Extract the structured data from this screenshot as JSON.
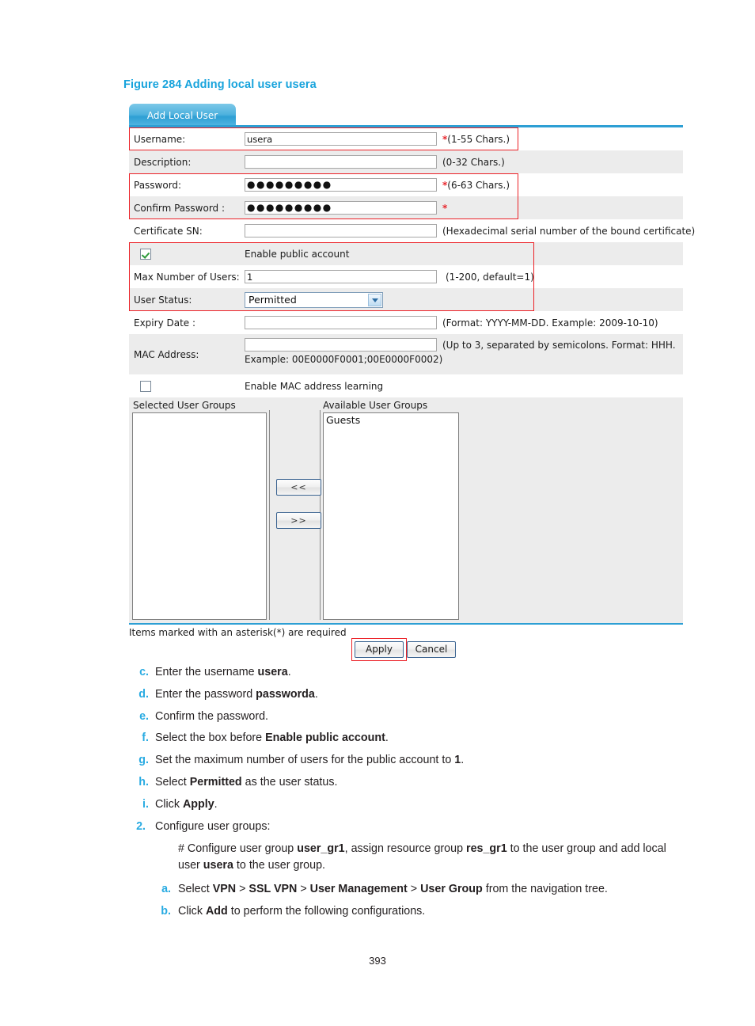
{
  "figure": {
    "caption": "Figure 284 Adding local user usera"
  },
  "panel": {
    "tab_label": "Add Local User",
    "rows": [
      {
        "label": "Username:",
        "value": "usera",
        "hint": "(1-55 Chars.)",
        "required": true
      },
      {
        "label": "Description:",
        "value": "",
        "hint": "(0-32 Chars.)",
        "required": false
      },
      {
        "label": "Password:",
        "value": "●●●●●●●●●",
        "hint": "(6-63 Chars.)",
        "required": true
      },
      {
        "label": "Confirm Password :",
        "value": "●●●●●●●●●",
        "hint": "",
        "required": true
      },
      {
        "label": "Certificate SN:",
        "value": "",
        "hint": "(Hexadecimal serial number of the bound certificate)",
        "required": false
      }
    ],
    "public_account": {
      "checkbox_label": "Enable public account",
      "checked": true,
      "max_users_label": "Max Number of Users:",
      "max_users_value": "1",
      "max_users_hint": "(1-200, default=1)",
      "user_status_label": "User Status:",
      "user_status_value": "Permitted",
      "user_status_options": [
        "Permitted"
      ]
    },
    "expiry": {
      "label": "Expiry Date :",
      "value": "",
      "hint": "(Format: YYYY-MM-DD. Example: 2009-10-10)"
    },
    "mac": {
      "label": "MAC Address:",
      "value": "",
      "hint": "(Up to 3, separated by semicolons. Format: HHH.",
      "example": "Example: 00E0000F0001;00E0000F0002)"
    },
    "mac_learning": {
      "checkbox_label": "Enable MAC address learning",
      "checked": false
    },
    "groups": {
      "selected_label": "Selected User Groups",
      "available_label": "Available User Groups",
      "selected_items": [],
      "available_items": [
        "Guests"
      ],
      "move_left_label": "<<",
      "move_right_label": ">>"
    },
    "footnote": "Items marked with an asterisk(*) are required",
    "apply_label": "Apply",
    "cancel_label": "Cancel",
    "accent_color": "#2d9fd4",
    "highlight_color": "#ec2127"
  },
  "instructions": {
    "steps": [
      {
        "marker": "c.",
        "parts": [
          {
            "t": "Enter the username "
          },
          {
            "t": "usera",
            "b": true
          },
          {
            "t": "."
          }
        ]
      },
      {
        "marker": "d.",
        "parts": [
          {
            "t": "Enter the password "
          },
          {
            "t": "passworda",
            "b": true
          },
          {
            "t": "."
          }
        ]
      },
      {
        "marker": "e.",
        "parts": [
          {
            "t": "Confirm the password."
          }
        ]
      },
      {
        "marker": "f.",
        "parts": [
          {
            "t": "Select the box before "
          },
          {
            "t": "Enable public account",
            "b": true
          },
          {
            "t": "."
          }
        ]
      },
      {
        "marker": "g.",
        "parts": [
          {
            "t": "Set the maximum number of users for the public account to "
          },
          {
            "t": "1",
            "b": true
          },
          {
            "t": "."
          }
        ]
      },
      {
        "marker": "h.",
        "parts": [
          {
            "t": "Select "
          },
          {
            "t": "Permitted",
            "b": true
          },
          {
            "t": " as the user status."
          }
        ]
      },
      {
        "marker": "i.",
        "parts": [
          {
            "t": "Click "
          },
          {
            "t": "Apply",
            "b": true
          },
          {
            "t": "."
          }
        ]
      }
    ],
    "step2": {
      "marker": "2.",
      "title": "Configure user groups:",
      "paragraph": [
        {
          "t": "# Configure user group "
        },
        {
          "t": "user_gr1",
          "b": true
        },
        {
          "t": ", assign resource group "
        },
        {
          "t": "res_gr1",
          "b": true
        },
        {
          "t": " to the user group and add local user "
        },
        {
          "t": "usera",
          "b": true
        },
        {
          "t": " to the user group."
        }
      ],
      "substeps": [
        {
          "marker": "a.",
          "parts": [
            {
              "t": "Select "
            },
            {
              "t": "VPN",
              "b": true
            },
            {
              "t": " > "
            },
            {
              "t": "SSL VPN",
              "b": true
            },
            {
              "t": " > "
            },
            {
              "t": "User Management",
              "b": true
            },
            {
              "t": " > "
            },
            {
              "t": "User Group",
              "b": true
            },
            {
              "t": " from the navigation tree."
            }
          ]
        },
        {
          "marker": "b.",
          "parts": [
            {
              "t": "Click "
            },
            {
              "t": "Add",
              "b": true
            },
            {
              "t": " to perform the following configurations."
            }
          ]
        }
      ]
    }
  },
  "page_number": "393"
}
